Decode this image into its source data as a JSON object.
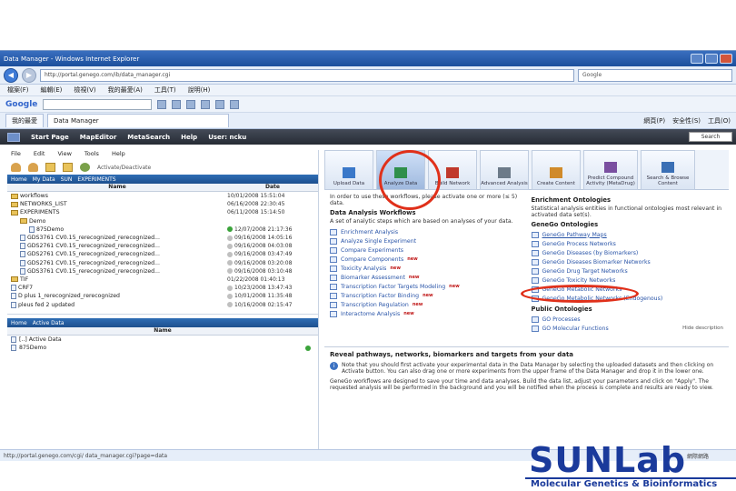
{
  "browser": {
    "title": "Data Manager - Windows Internet Explorer",
    "url": "http://portal.genego.com/ib/data_manager.cgi",
    "search_placeholder": "Google",
    "menu": [
      "檔案(F)",
      "編輯(E)",
      "檢視(V)",
      "我的最愛(A)",
      "工具(T)",
      "說明(H)"
    ],
    "google_label": "Google",
    "tab_favorites": "我的最愛",
    "tab_active": "Data Manager",
    "right_tools": [
      "網頁(P)",
      "安全性(S)",
      "工具(O)"
    ],
    "status_url": "http://portal.genego.com/cgi/ data_manager.cgi?page=data",
    "status_zone": "網際網路"
  },
  "appnav": {
    "items": [
      "Start Page",
      "MapEditor",
      "MetaSearch",
      "Help",
      "User: ncku"
    ],
    "search_btn": "Search"
  },
  "data_manager": {
    "menu": [
      "File",
      "Edit",
      "View",
      "Tools",
      "Help"
    ],
    "activate_label": "Activate/Deactivate",
    "breadcrumb": [
      "Home",
      "My Data",
      "SUN",
      "EXPERIMENTS"
    ],
    "col_name": "Name",
    "col_date": "Date",
    "rows": [
      {
        "name": "workflows",
        "type": "folder",
        "indent": 0,
        "date": "10/01/2008 15:51:04",
        "status": ""
      },
      {
        "name": "NETWORKS_LIST",
        "type": "folder",
        "indent": 0,
        "date": "06/16/2008 22:30:45",
        "status": ""
      },
      {
        "name": "EXPERIMENTS",
        "type": "folder",
        "indent": 0,
        "date": "06/11/2008 15:14:50",
        "status": ""
      },
      {
        "name": "Demo",
        "type": "folder",
        "indent": 1,
        "date": "",
        "status": ""
      },
      {
        "name": "875Demo",
        "type": "file",
        "indent": 2,
        "date": "12/07/2008 21:17:36",
        "status": "ok"
      },
      {
        "name": "GDS3761 CV0.15_rerecognized_rerecognized...",
        "type": "file",
        "indent": 1,
        "date": "09/16/2008 14:05:16",
        "status": "pending"
      },
      {
        "name": "GDS2761 CV0.15_rerecognized_rerecognized...",
        "type": "file",
        "indent": 1,
        "date": "09/16/2008 04:03:08",
        "status": "pending"
      },
      {
        "name": "GDS2761 CV0.15_rerecognized_rerecognized...",
        "type": "file",
        "indent": 1,
        "date": "09/16/2008 03:47:49",
        "status": "pending"
      },
      {
        "name": "GDS2761 CV0.15_rerecognized_rerecognized...",
        "type": "file",
        "indent": 1,
        "date": "09/16/2008 03:20:08",
        "status": "pending"
      },
      {
        "name": "GDS3761 CV0.15_rerecognized_rerecognized...",
        "type": "file",
        "indent": 1,
        "date": "09/16/2008 03:10:48",
        "status": "pending"
      },
      {
        "name": "TIF",
        "type": "folder",
        "indent": 0,
        "date": "01/22/2008 01:40:13",
        "status": ""
      },
      {
        "name": "CRF7",
        "type": "file",
        "indent": 0,
        "date": "10/23/2008 13:47:43",
        "status": "pending"
      },
      {
        "name": "D plus 1_rerecognized_rerecognized",
        "type": "file",
        "indent": 0,
        "date": "10/01/2008 11:35:48",
        "status": "pending"
      },
      {
        "name": "pleus fed 2 updated",
        "type": "file",
        "indent": 0,
        "date": "10/16/2008 02:15:47",
        "status": "pending"
      }
    ],
    "active_breadcrumb": [
      "Home",
      "Active Data"
    ],
    "active_col": "Name",
    "active_rows": [
      {
        "name": "[..] Active Data",
        "status": ""
      },
      {
        "name": "875Demo",
        "status": "ok"
      }
    ]
  },
  "toolbar": [
    {
      "label": "Upload Data",
      "icon": "upload-icon",
      "active": false
    },
    {
      "label": "Analyze Data",
      "icon": "analyze-icon",
      "active": true
    },
    {
      "label": "Build Network",
      "icon": "network-icon",
      "active": false
    },
    {
      "label": "Advanced Analysis",
      "icon": "advanced-icon",
      "active": false
    },
    {
      "label": "Create Content",
      "icon": "create-icon",
      "active": false
    },
    {
      "label": "Predict Compound Activity (MetaDrug)",
      "icon": "predict-icon",
      "active": false
    },
    {
      "label": "Search & Browse Content",
      "icon": "search-browse-icon",
      "active": false
    }
  ],
  "left_col": {
    "intro": "In order to use these workflows, please activate one or more (≤ 5) data.",
    "workflows_title": "Data Analysis Workflows",
    "workflows_desc": "A set of analytic steps which are based on analyses of your data.",
    "workflows": [
      {
        "label": "Enrichment Analysis",
        "new": ""
      },
      {
        "label": "Analyze Single Experiment",
        "new": ""
      },
      {
        "label": "Compare Experiments",
        "new": ""
      },
      {
        "label": "Compare Components",
        "new": "new"
      },
      {
        "label": "Toxicity Analysis",
        "new": "new"
      },
      {
        "label": "Biomarker Assessment",
        "new": "new"
      },
      {
        "label": "Transcription Factor Targets Modeling",
        "new": "new"
      },
      {
        "label": "Transcription Factor Binding",
        "new": "new"
      },
      {
        "label": "Transcription Regulation",
        "new": "new"
      },
      {
        "label": "Interactome Analysis",
        "new": "new"
      }
    ]
  },
  "right_col": {
    "enrichment_title": "Enrichment Ontologies",
    "enrichment_desc": "Statistical analysis entities in functional ontologies most relevant in activated data set(s).",
    "genego_title": "GeneGo Ontologies",
    "genego": [
      "GeneGo Pathway Maps",
      "GeneGo Process Networks",
      "GeneGo Diseases (by Biomarkers)",
      "GeneGo Diseases Biomarker Networks",
      "GeneGo Drug Target Networks",
      "GeneGo Toxicity Networks",
      "GeneGo Metabolic Networks",
      "GeneGo Metabolic Networks (Endogenous)"
    ],
    "public_title": "Public Ontologies",
    "public": [
      "GO Processes",
      "GO Molecular Functions"
    ],
    "hide_desc": "Hide description"
  },
  "reveal": {
    "title": "Reveal pathways, networks, biomarkers and targets from your data",
    "note": "Note that you should first activate your experimental data in the Data Manager by selecting the uploaded datasets and then clicking on Activate button. You can also drag one or more experiments from the upper frame of the Data Manager and drop it in the lower one.",
    "para": "GeneGo workflows are designed to save your time and data analyses. Build the data list, adjust your parameters and click on \"Apply\". The requested analysis will be performed in the background and you will be notified when the process is complete and results are ready to view."
  },
  "brand": {
    "name": "SUNLab",
    "subtitle": "Molecular Genetics & Bioinformatics"
  },
  "colors": {
    "annotation": "#e0301a",
    "nav_dark": "#262b34",
    "link_blue": "#2a55a8",
    "brand_blue": "#1a3a9b"
  }
}
